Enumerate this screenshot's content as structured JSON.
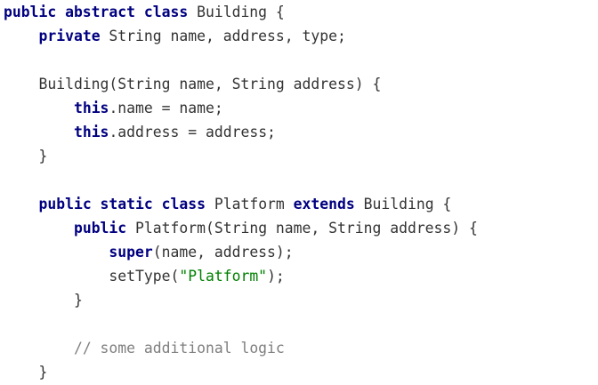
{
  "code_lines": [
    [
      {
        "t": "public abstract class",
        "k": "kw"
      },
      {
        "t": " Building {"
      }
    ],
    [
      {
        "t": "    "
      },
      {
        "t": "private",
        "k": "kw"
      },
      {
        "t": " String name, address, type;"
      }
    ],
    [],
    [
      {
        "t": "    Building(String name, String address) {"
      }
    ],
    [
      {
        "t": "        "
      },
      {
        "t": "this",
        "k": "kw"
      },
      {
        "t": ".name = name;"
      }
    ],
    [
      {
        "t": "        "
      },
      {
        "t": "this",
        "k": "kw"
      },
      {
        "t": ".address = address;"
      }
    ],
    [
      {
        "t": "    }"
      }
    ],
    [],
    [
      {
        "t": "    "
      },
      {
        "t": "public static class",
        "k": "kw"
      },
      {
        "t": " Platform "
      },
      {
        "t": "extends",
        "k": "kw"
      },
      {
        "t": " Building {"
      }
    ],
    [
      {
        "t": "        "
      },
      {
        "t": "public",
        "k": "kw"
      },
      {
        "t": " Platform(String name, String address) {"
      }
    ],
    [
      {
        "t": "            "
      },
      {
        "t": "super",
        "k": "kw"
      },
      {
        "t": "(name, address);"
      }
    ],
    [
      {
        "t": "            setType("
      },
      {
        "t": "\"Platform\"",
        "k": "str"
      },
      {
        "t": ");"
      }
    ],
    [
      {
        "t": "        }"
      }
    ],
    [],
    [
      {
        "t": "        "
      },
      {
        "t": "// some additional logic",
        "k": "cmt"
      }
    ],
    [
      {
        "t": "    }"
      }
    ]
  ]
}
